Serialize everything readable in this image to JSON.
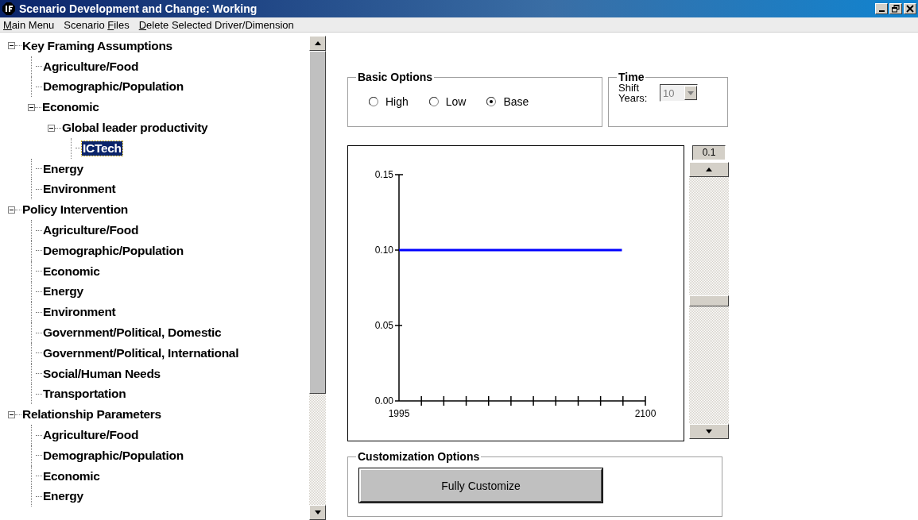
{
  "window": {
    "title": "Scenario Development and Change: Working"
  },
  "menu": [
    {
      "key": "M",
      "after": "ain Menu"
    },
    {
      "before": "Scenario ",
      "key": "F",
      "after": "iles"
    },
    {
      "key": "D",
      "after": "elete Selected Driver/Dimension"
    }
  ],
  "tree": [
    {
      "label": "Key Framing Assumptions",
      "expanded": true,
      "selected": false,
      "children": [
        {
          "label": "Agriculture/Food",
          "selected": false
        },
        {
          "label": "Demographic/Population",
          "selected": false
        },
        {
          "label": "Economic",
          "expanded": true,
          "selected": false,
          "children": [
            {
              "label": "Global leader productivity",
              "expanded": true,
              "selected": false,
              "children": [
                {
                  "label": "ICTech",
                  "selected": true
                }
              ]
            }
          ]
        },
        {
          "label": "Energy",
          "selected": false
        },
        {
          "label": "Environment",
          "selected": false
        }
      ]
    },
    {
      "label": "Policy Intervention",
      "expanded": true,
      "selected": false,
      "children": [
        {
          "label": "Agriculture/Food",
          "selected": false
        },
        {
          "label": "Demographic/Population",
          "selected": false
        },
        {
          "label": "Economic",
          "selected": false
        },
        {
          "label": "Energy",
          "selected": false
        },
        {
          "label": "Environment",
          "selected": false
        },
        {
          "label": "Government/Political, Domestic",
          "selected": false
        },
        {
          "label": "Government/Political, International",
          "selected": false
        },
        {
          "label": "Social/Human Needs",
          "selected": false
        },
        {
          "label": "Transportation",
          "selected": false
        }
      ]
    },
    {
      "label": "Relationship Parameters",
      "expanded": true,
      "selected": false,
      "children": [
        {
          "label": "Agriculture/Food",
          "selected": false
        },
        {
          "label": "Demographic/Population",
          "selected": false
        },
        {
          "label": "Economic",
          "selected": false
        },
        {
          "label": "Energy",
          "selected": false
        }
      ]
    }
  ],
  "basic_options": {
    "title": "Basic Options",
    "options": [
      {
        "label": "High",
        "selected": false
      },
      {
        "label": "Low",
        "selected": false
      },
      {
        "label": "Base",
        "selected": true
      }
    ]
  },
  "time": {
    "title": "Time",
    "label": "Shift Years:",
    "value": "10",
    "disabled": true
  },
  "chart": {
    "chart_data": {
      "type": "line",
      "x": [
        1995,
        2090
      ],
      "series": [
        {
          "color": "#0000ff",
          "values": [
            0.1,
            0.1
          ]
        }
      ],
      "xlim": [
        1995,
        2100
      ],
      "ylim": [
        0,
        0.15
      ],
      "xticks": [
        1995,
        2100
      ],
      "yticks": [
        {
          "value": 0,
          "label": "0.00"
        },
        {
          "value": 0.05,
          "label": "0.05"
        },
        {
          "value": 0.1,
          "label": "0.10"
        },
        {
          "value": 0.15,
          "label": "0.15"
        }
      ]
    }
  },
  "value_slider": {
    "reading": "0.1",
    "level": 0.5
  },
  "customization": {
    "title": "Customization Options",
    "button": "Fully Customize"
  }
}
